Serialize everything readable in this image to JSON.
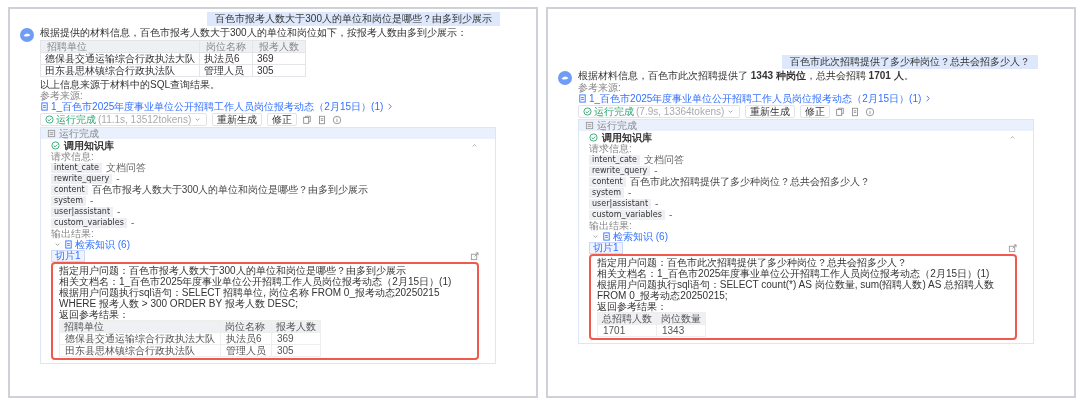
{
  "panels": [
    {
      "question": "百色市报考人数大于300人的单位和岗位是哪些？由多到少展示",
      "answer": "根据提供的材料信息，百色市报考人数大于300人的单位和岗位如下，按报考人数由多到少展示：",
      "table": {
        "columns": [
          "招聘单位",
          "岗位名称",
          "报考人数"
        ],
        "rows": [
          [
            "德保县交通运输综合行政执法大队",
            "执法员6",
            "369"
          ],
          [
            "田东县思林镇综合行政执法队",
            "管理人员",
            "305"
          ]
        ]
      },
      "conclusion": "以上信息来源于材料中的SQL查询结果。",
      "sources_label": "参考来源:",
      "source_link": "1_百色市2025年度事业单位公开招聘工作人员岗位报考动态（2月15日）(1)",
      "status": {
        "label": "运行完成",
        "detail": "(11.1s, 13512tokens)"
      },
      "buttons": [
        "重新生成",
        "修正"
      ],
      "run_bar": "运行完成",
      "kb_title": "调用知识库",
      "request_label": "请求信息:",
      "params": [
        {
          "key": "intent_cate",
          "value": "文档问答"
        },
        {
          "key": "rewrite_query",
          "value": "-"
        },
        {
          "key": "content",
          "value": "百色市报考人数大于300人的单位和岗位是哪些？由多到少展示"
        },
        {
          "key": "system",
          "value": "-"
        },
        {
          "key": "user|assistant",
          "value": "-"
        },
        {
          "key": "custom_variables",
          "value": "-"
        }
      ],
      "output_label": "输出结果:",
      "retrieval": "检索知识 (6)",
      "slice": "切片1",
      "result": {
        "lines": [
          "指定用户问题：百色市报考人数大于300人的单位和岗位是哪些？由多到少展示",
          "相关文档名：1_百色市2025年度事业单位公开招聘工作人员岗位报考动态（2月15日）(1)",
          "根据用户问题执行sql语句：SELECT 招聘单位, 岗位名称 FROM 0_报考动态20250215 WHERE 报考人数 > 300 ORDER BY 报考人数 DESC;",
          "返回参考结果："
        ],
        "table": {
          "columns": [
            "招聘单位",
            "岗位名称",
            "报考人数"
          ],
          "rows": [
            [
              "德保县交通运输综合行政执法大队",
              "执法员6",
              "369"
            ],
            [
              "田东县思林镇综合行政执法队",
              "管理人员",
              "305"
            ]
          ]
        }
      }
    },
    {
      "question": "百色市此次招聘提供了多少种岗位？总共会招多少人？",
      "answer": "根据材料信息，百色市此次招聘提供了 **1343 种岗位**，总共会招聘 **1701 人**。",
      "sources_label": "参考来源:",
      "source_link": "1_百色市2025年度事业单位公开招聘工作人员岗位报考动态（2月15日）(1)",
      "status": {
        "label": "运行完成",
        "detail": "(7.9s, 13364tokens)"
      },
      "buttons": [
        "重新生成",
        "修正"
      ],
      "run_bar": "运行完成",
      "kb_title": "调用知识库",
      "request_label": "请求信息:",
      "params": [
        {
          "key": "intent_cate",
          "value": "文档问答"
        },
        {
          "key": "rewrite_query",
          "value": "-"
        },
        {
          "key": "content",
          "value": "百色市此次招聘提供了多少种岗位？总共会招多少人？"
        },
        {
          "key": "system",
          "value": "-"
        },
        {
          "key": "user|assistant",
          "value": "-"
        },
        {
          "key": "custom_variables",
          "value": "-"
        }
      ],
      "output_label": "输出结果:",
      "retrieval": "检索知识 (6)",
      "slice": "切片1",
      "result": {
        "lines": [
          "指定用户问题：百色市此次招聘提供了多少种岗位？总共会招多少人？",
          "相关文档名：1_百色市2025年度事业单位公开招聘工作人员岗位报考动态（2月15日）(1)",
          "根据用户问题执行sql语句：SELECT count(*) AS 岗位数量, sum(招聘人数) AS 总招聘人数 FROM 0_报考动态20250215;",
          "返回参考结果："
        ],
        "table": {
          "columns": [
            "总招聘人数",
            "岗位数量"
          ],
          "rows": [
            [
              "1701",
              "1343"
            ]
          ]
        }
      }
    }
  ]
}
